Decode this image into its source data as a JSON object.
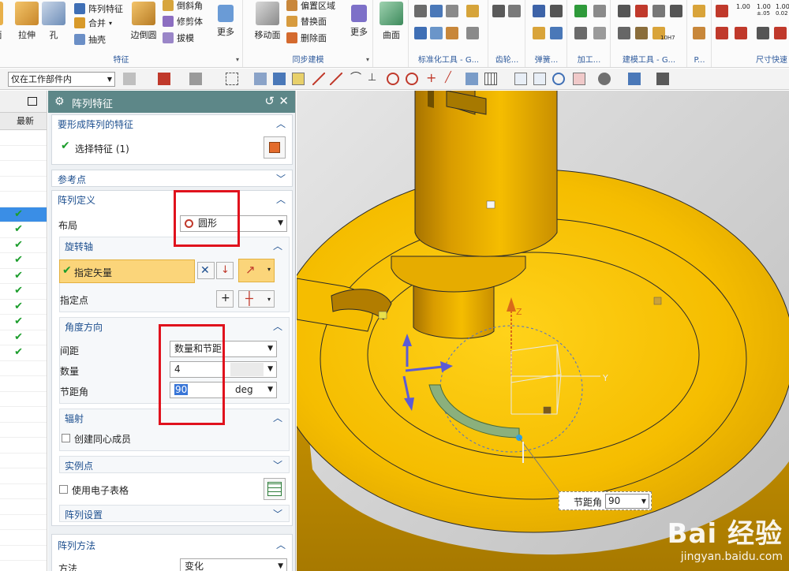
{
  "ribbon": {
    "groups": {
      "feature": {
        "label": "特征",
        "buttons": {
          "extrude": "拉伸",
          "hole": "孔",
          "pattern_feature": "阵列特征",
          "unite": "合并",
          "shell": "抽壳",
          "edge_blend": "边倒圆",
          "chamfer": "倒斜角",
          "trim_body": "修剪体",
          "draft": "拔模",
          "more": "更多"
        }
      },
      "sync": {
        "label": "同步建模",
        "buttons": {
          "move_face": "移动面",
          "offset_region": "偏置区域",
          "replace_face": "替换面",
          "delete_face": "删除面",
          "more": "更多"
        }
      },
      "surface": {
        "buttons": {
          "surface": "曲面"
        }
      },
      "standard_tools": {
        "label": "标准化工具 - G..."
      },
      "gear": {
        "label": "齿轮..."
      },
      "spring": {
        "label": "弹簧..."
      },
      "machining": {
        "label": "加工..."
      },
      "modeling_tools": {
        "label": "建模工具 - G..."
      },
      "p": {
        "label": "P..."
      },
      "dimension": {
        "label": "尺寸快速"
      },
      "tiny_labels": {
        "tol1": "1.00",
        "tol2": "1.00",
        "tol3": "1.00",
        "tol3b": "0.02",
        "tol2b": "±.05",
        "fit": "10H7"
      }
    }
  },
  "toolbar": {
    "scope_select": "仅在工作部件内"
  },
  "navigator": {
    "column_latest": "最新",
    "check_glyph": "✔",
    "rows": [
      {
        "checked": false,
        "selected": false
      },
      {
        "checked": false,
        "selected": false
      },
      {
        "checked": false,
        "selected": false
      },
      {
        "checked": false,
        "selected": false
      },
      {
        "checked": false,
        "selected": false
      },
      {
        "checked": true,
        "selected": true
      },
      {
        "checked": true,
        "selected": false
      },
      {
        "checked": true,
        "selected": false
      },
      {
        "checked": true,
        "selected": false
      },
      {
        "checked": true,
        "selected": false
      },
      {
        "checked": true,
        "selected": false
      },
      {
        "checked": true,
        "selected": false
      },
      {
        "checked": true,
        "selected": false
      },
      {
        "checked": true,
        "selected": false
      },
      {
        "checked": true,
        "selected": false
      },
      {
        "checked": false,
        "selected": false
      },
      {
        "checked": false,
        "selected": false
      },
      {
        "checked": false,
        "selected": false
      },
      {
        "checked": false,
        "selected": false
      },
      {
        "checked": false,
        "selected": false
      },
      {
        "checked": false,
        "selected": false
      },
      {
        "checked": false,
        "selected": false
      },
      {
        "checked": false,
        "selected": false
      },
      {
        "checked": false,
        "selected": false
      },
      {
        "checked": false,
        "selected": false
      },
      {
        "checked": false,
        "selected": false
      },
      {
        "checked": false,
        "selected": false
      },
      {
        "checked": false,
        "selected": false
      }
    ]
  },
  "dialog": {
    "title": "阵列特征",
    "features_section": {
      "title": "要形成阵列的特征",
      "select_feature": "选择特征 (1)"
    },
    "reference_section": {
      "title": "参考点"
    },
    "definition_section": {
      "title": "阵列定义",
      "layout_label": "布局",
      "layout_value": "圆形",
      "rotation_axis": {
        "title": "旋转轴",
        "specify_vector": "指定矢量",
        "specify_point": "指定点"
      },
      "angle_direction": {
        "title": "角度方向",
        "spacing_label": "间距",
        "spacing_value": "数量和节距",
        "count_label": "数量",
        "count_value": "4",
        "pitch_label": "节距角",
        "pitch_value": "90",
        "pitch_unit": "deg"
      },
      "radial": {
        "title": "辐射",
        "create_concentric": "创建同心成员"
      },
      "instance_points": {
        "title": "实例点"
      },
      "use_spreadsheet": "使用电子表格",
      "pattern_settings": {
        "title": "阵列设置"
      }
    },
    "method_section": {
      "title": "阵列方法",
      "method_label": "方法",
      "method_value": "变化"
    }
  },
  "viewport": {
    "axis_labels": {
      "z": "Z",
      "y": "Y"
    },
    "pitch_box": {
      "label": "节距角",
      "value": "90"
    },
    "watermark": {
      "logo": "Bai 经验",
      "url": "jingyan.baidu.com"
    }
  },
  "colors": {
    "part_yellow": "#f5bd00",
    "dialog_title": "#5d8788",
    "section_title": "#1d4f8f",
    "highlight_red": "#e0121d",
    "row_selected": "#3a8ee6"
  }
}
